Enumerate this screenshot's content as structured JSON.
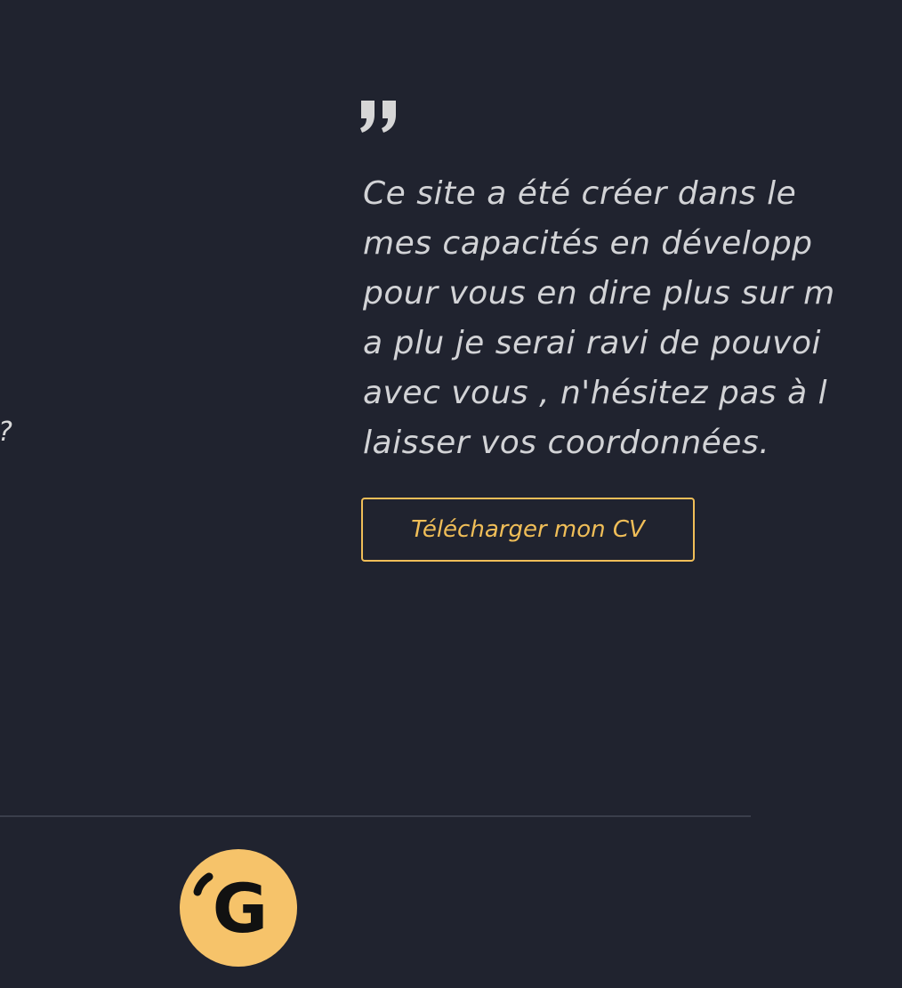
{
  "left_fragment": "?",
  "quote": {
    "icon": "closing-quote-icon",
    "lines": [
      "Ce site a été créer dans le",
      "mes capacités en développ",
      "pour vous en dire plus sur m",
      "a plu je serai ravi de pouvoi",
      "avec vous , n'hésitez pas à l",
      "laisser vos coordonnées."
    ]
  },
  "cv_button": {
    "label": "Télécharger mon CV"
  },
  "footer": {
    "logo_letter": "G",
    "logo_icon": "logo-g-icon"
  },
  "colors": {
    "background": "#20232f",
    "accent": "#f0be58",
    "logo_fill": "#f6c36a",
    "text": "#d2d3d6"
  }
}
